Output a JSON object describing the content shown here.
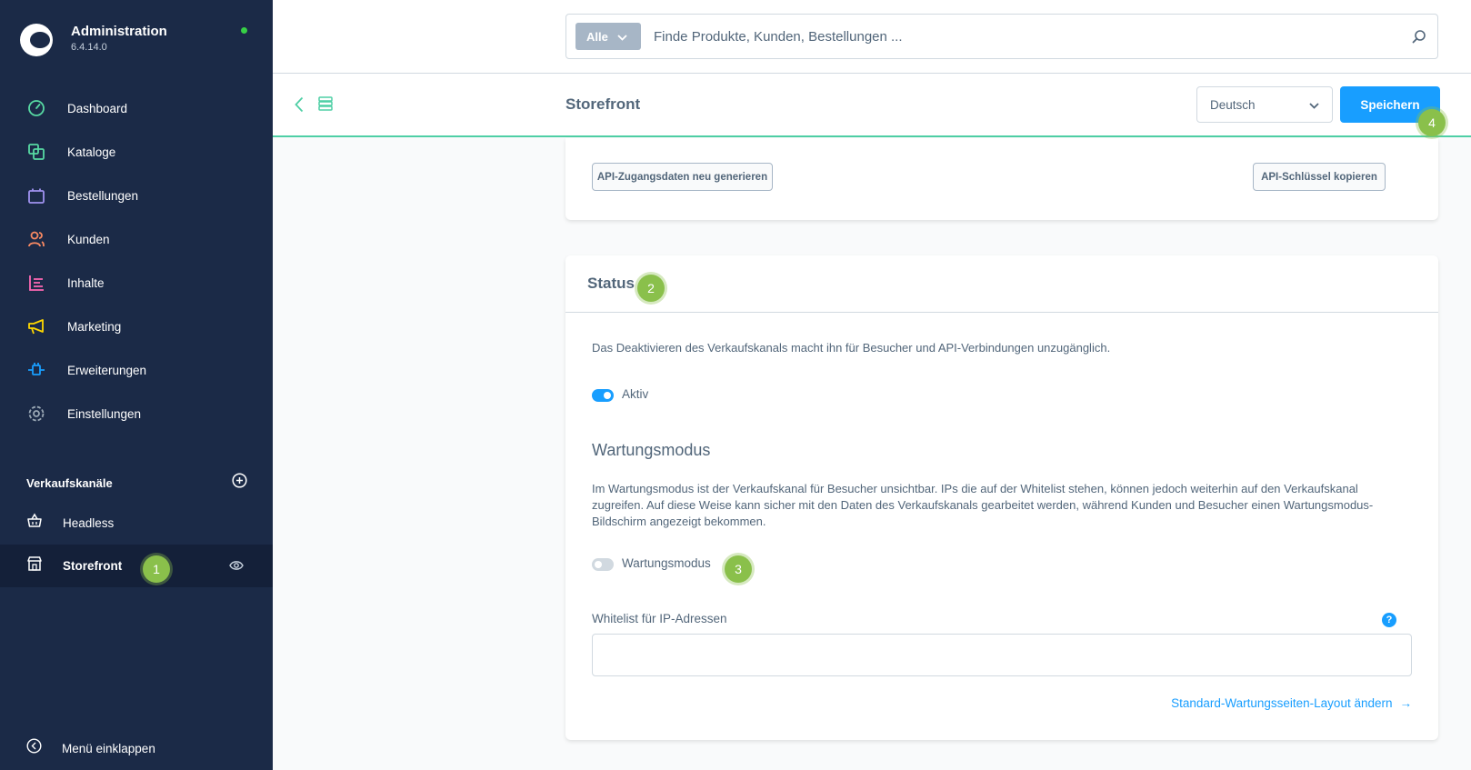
{
  "brand": {
    "title": "Administration",
    "version": "6.4.14.0"
  },
  "nav": {
    "items": [
      {
        "label": "Dashboard",
        "icon": "dashboard-icon",
        "color": "#57d9a3"
      },
      {
        "label": "Kataloge",
        "icon": "catalog-icon",
        "color": "#57d9a3"
      },
      {
        "label": "Bestellungen",
        "icon": "orders-icon",
        "color": "#a092f0"
      },
      {
        "label": "Kunden",
        "icon": "customers-icon",
        "color": "#f88962"
      },
      {
        "label": "Inhalte",
        "icon": "content-icon",
        "color": "#ff68b4"
      },
      {
        "label": "Marketing",
        "icon": "marketing-icon",
        "color": "#ffd700"
      },
      {
        "label": "Erweiterungen",
        "icon": "extensions-icon",
        "color": "#189eff"
      },
      {
        "label": "Einstellungen",
        "icon": "settings-icon",
        "color": "#9aa8b5"
      }
    ]
  },
  "sales_channels": {
    "title": "Verkaufskanäle",
    "items": [
      {
        "label": "Headless",
        "active": false
      },
      {
        "label": "Storefront",
        "active": true
      }
    ]
  },
  "collapse_label": "Menü einklappen",
  "search": {
    "type_label": "Alle",
    "placeholder": "Finde Produkte, Kunden, Bestellungen ..."
  },
  "smartbar": {
    "title": "Storefront",
    "language": "Deutsch",
    "save_label": "Speichern"
  },
  "api_card": {
    "regenerate_label": "API-Zugangsdaten neu generieren",
    "copy_key_label": "API-Schlüssel kopieren"
  },
  "status_card": {
    "title": "Status",
    "description": "Das Deaktivieren des Verkaufskanals macht ihn für Besucher und API-Verbindungen unzugänglich.",
    "active_label": "Aktiv",
    "active_on": true,
    "maintenance_title": "Wartungsmodus",
    "maintenance_description": "Im Wartungsmodus ist der Verkaufskanal für Besucher unsichtbar. IPs die auf der Whitelist stehen, können jedoch weiterhin auf den Verkaufskanal zugreifen. Auf diese Weise kann sicher mit den Daten des Verkaufskanals gearbeitet werden, während Kunden und Besucher einen Wartungsmodus-Bildschirm angezeigt bekommen.",
    "maintenance_label": "Wartungsmodus",
    "maintenance_on": false,
    "whitelist_label": "Whitelist für IP-Adressen",
    "whitelist_value": "",
    "help_glyph": "?",
    "layout_link": "Standard-Wartungsseiten-Layout ändern",
    "layout_link_arrow": "→"
  },
  "markers": [
    "1",
    "2",
    "3",
    "4"
  ],
  "colors": {
    "sidebar": "#1b2a47",
    "accent": "#189eff",
    "marker": "#8ac04b",
    "online": "#37d046"
  }
}
